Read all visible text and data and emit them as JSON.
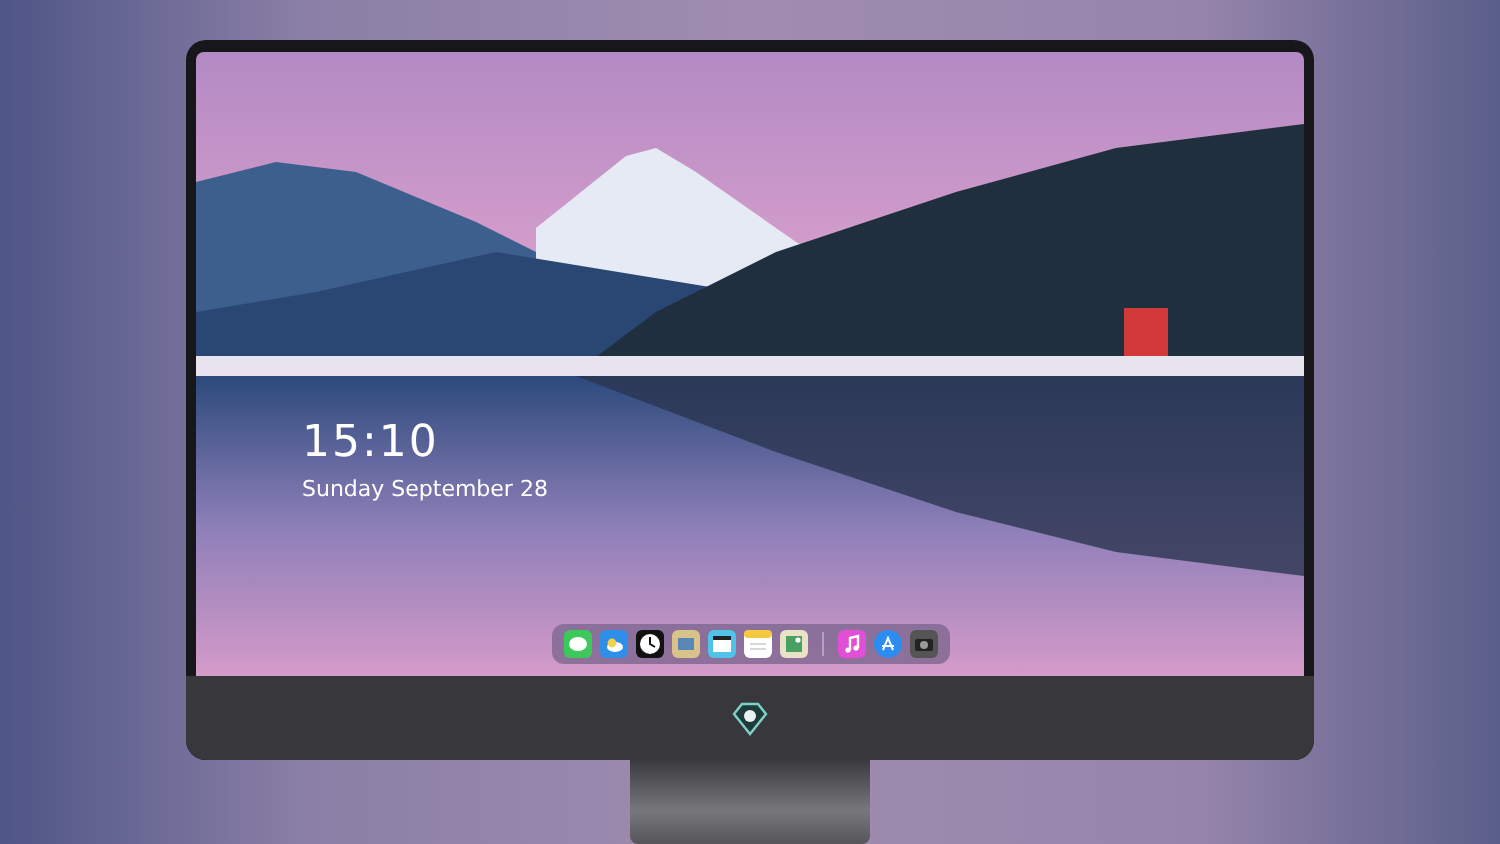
{
  "lock_screen": {
    "time": "15:10",
    "date": "Sunday September 28"
  },
  "dock": {
    "groups": [
      [
        {
          "kind": "chat"
        },
        {
          "kind": "cloud"
        },
        {
          "kind": "clock"
        },
        {
          "kind": "card"
        },
        {
          "kind": "film"
        },
        {
          "kind": "notes"
        },
        {
          "kind": "picture"
        }
      ],
      [
        {
          "kind": "music"
        },
        {
          "kind": "store"
        },
        {
          "kind": "camera"
        }
      ]
    ]
  }
}
